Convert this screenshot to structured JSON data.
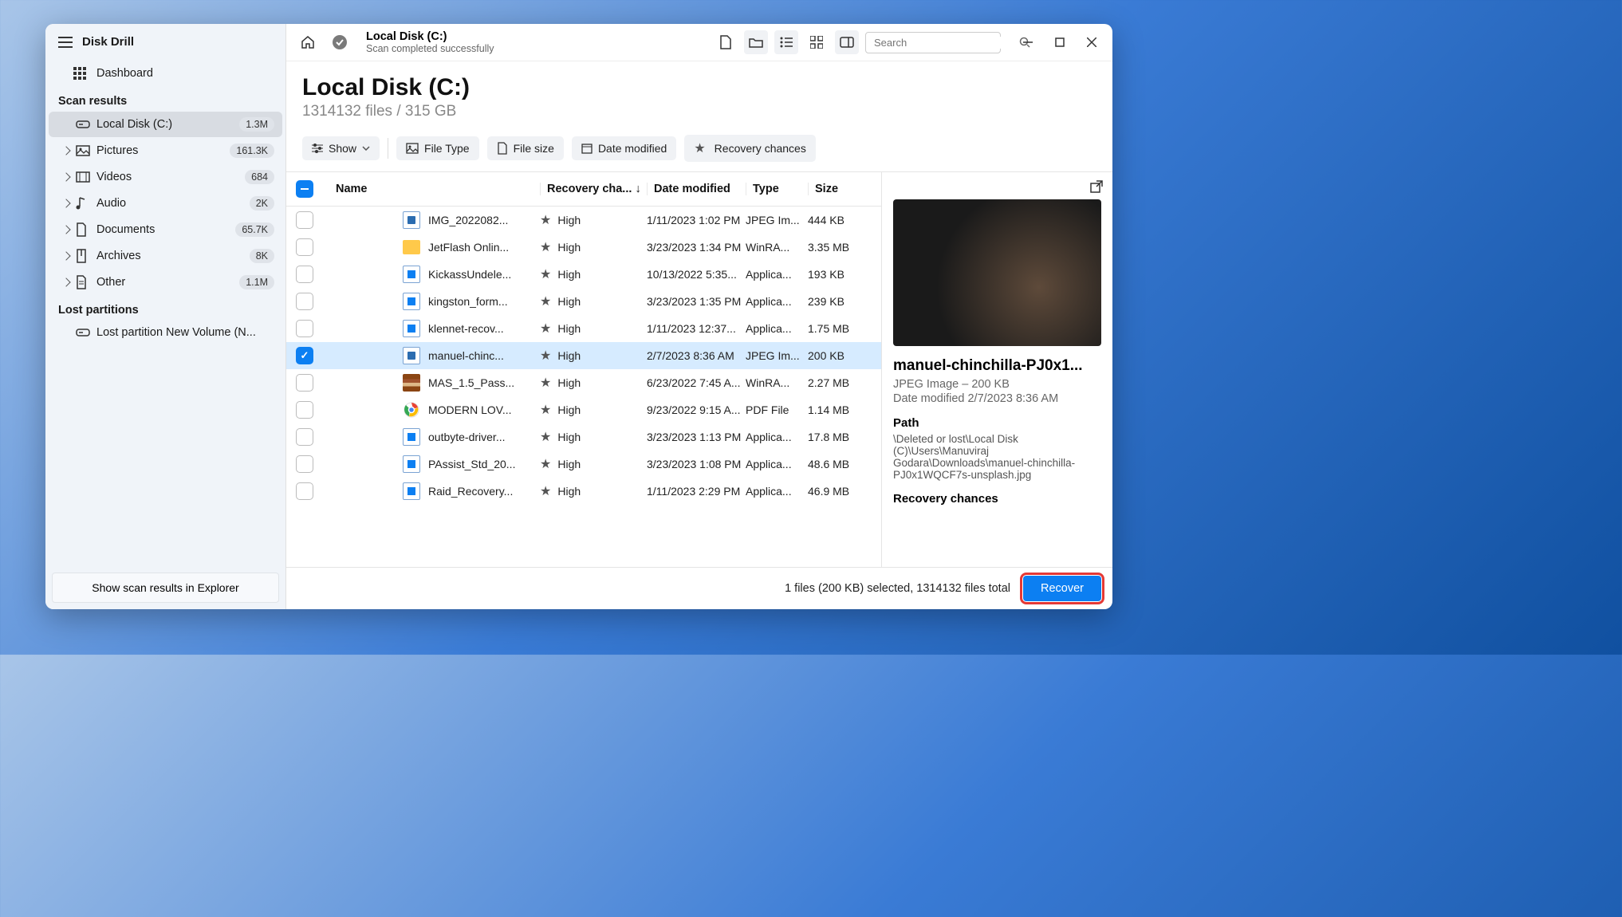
{
  "app": {
    "title": "Disk Drill"
  },
  "sidebar": {
    "dashboard": "Dashboard",
    "section_scan": "Scan results",
    "items": [
      {
        "label": "Local Disk (C:)",
        "badge": "1.3M",
        "icon": "drive",
        "active": true,
        "noexpand": true
      },
      {
        "label": "Pictures",
        "badge": "161.3K",
        "icon": "image"
      },
      {
        "label": "Videos",
        "badge": "684",
        "icon": "film"
      },
      {
        "label": "Audio",
        "badge": "2K",
        "icon": "music"
      },
      {
        "label": "Documents",
        "badge": "65.7K",
        "icon": "doc"
      },
      {
        "label": "Archives",
        "badge": "8K",
        "icon": "archive"
      },
      {
        "label": "Other",
        "badge": "1.1M",
        "icon": "other"
      }
    ],
    "section_lost": "Lost partitions",
    "lost_item": "Lost partition New Volume (N...",
    "footer_btn": "Show scan results in Explorer"
  },
  "topbar": {
    "title": "Local Disk (C:)",
    "subtitle": "Scan completed successfully",
    "search_placeholder": "Search"
  },
  "header": {
    "title": "Local Disk (C:)",
    "subtitle": "1314132 files / 315 GB"
  },
  "filters": {
    "show": "Show",
    "filetype": "File Type",
    "filesize": "File size",
    "datemod": "Date modified",
    "recovery": "Recovery chances"
  },
  "columns": {
    "name": "Name",
    "recovery": "Recovery cha...",
    "date": "Date modified",
    "type": "Type",
    "size": "Size"
  },
  "rows": [
    {
      "name": "IMG_2022082...",
      "rec": "High",
      "date": "1/11/2023 1:02 PM",
      "type": "JPEG Im...",
      "size": "444 KB",
      "icon": "doc"
    },
    {
      "name": "JetFlash Onlin...",
      "rec": "High",
      "date": "3/23/2023 1:34 PM",
      "type": "WinRA...",
      "size": "3.35 MB",
      "icon": "folder"
    },
    {
      "name": "KickassUndele...",
      "rec": "High",
      "date": "10/13/2022 5:35...",
      "type": "Applica...",
      "size": "193 KB",
      "icon": "exe"
    },
    {
      "name": "kingston_form...",
      "rec": "High",
      "date": "3/23/2023 1:35 PM",
      "type": "Applica...",
      "size": "239 KB",
      "icon": "exe"
    },
    {
      "name": "klennet-recov...",
      "rec": "High",
      "date": "1/11/2023 12:37...",
      "type": "Applica...",
      "size": "1.75 MB",
      "icon": "exe"
    },
    {
      "name": "manuel-chinc...",
      "rec": "High",
      "date": "2/7/2023 8:36 AM",
      "type": "JPEG Im...",
      "size": "200 KB",
      "icon": "doc",
      "selected": true
    },
    {
      "name": "MAS_1.5_Pass...",
      "rec": "High",
      "date": "6/23/2022 7:45 A...",
      "type": "WinRA...",
      "size": "2.27 MB",
      "icon": "rar"
    },
    {
      "name": "MODERN LOV...",
      "rec": "High",
      "date": "9/23/2022 9:15 A...",
      "type": "PDF File",
      "size": "1.14 MB",
      "icon": "chrome"
    },
    {
      "name": "outbyte-driver...",
      "rec": "High",
      "date": "3/23/2023 1:13 PM",
      "type": "Applica...",
      "size": "17.8 MB",
      "icon": "exe"
    },
    {
      "name": "PAssist_Std_20...",
      "rec": "High",
      "date": "3/23/2023 1:08 PM",
      "type": "Applica...",
      "size": "48.6 MB",
      "icon": "exe"
    },
    {
      "name": "Raid_Recovery...",
      "rec": "High",
      "date": "1/11/2023 2:29 PM",
      "type": "Applica...",
      "size": "46.9 MB",
      "icon": "exe"
    }
  ],
  "preview": {
    "title": "manuel-chinchilla-PJ0x1...",
    "meta1": "JPEG Image – 200 KB",
    "meta2": "Date modified 2/7/2023 8:36 AM",
    "path_label": "Path",
    "path": "\\Deleted or lost\\Local Disk (C)\\Users\\Manuviraj Godara\\Downloads\\manuel-chinchilla-PJ0x1WQCF7s-unsplash.jpg",
    "recovery_label": "Recovery chances"
  },
  "footer": {
    "status": "1 files (200 KB) selected, 1314132 files total",
    "recover": "Recover"
  }
}
